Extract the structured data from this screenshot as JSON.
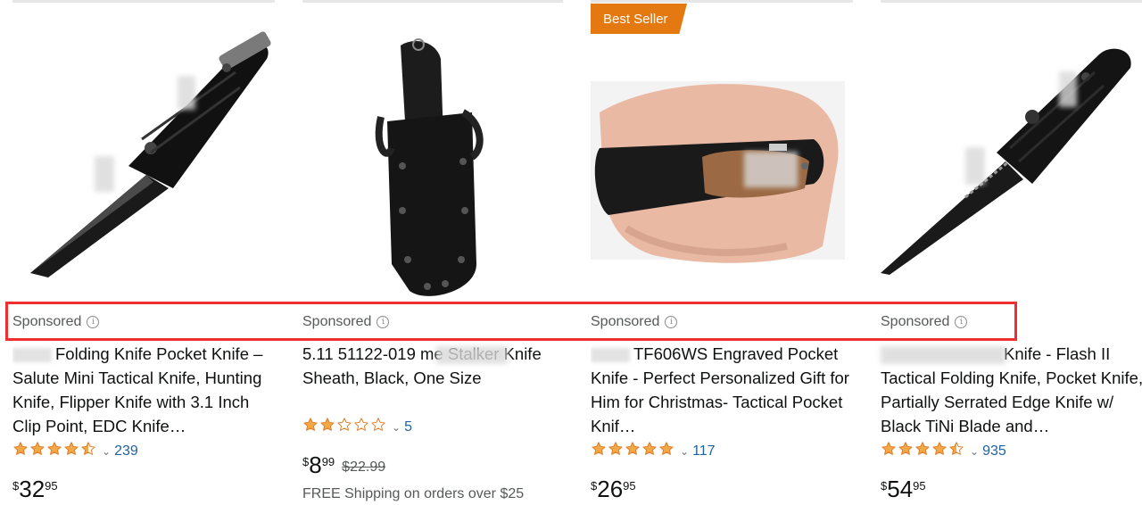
{
  "badge": "Best Seller",
  "products": [
    {
      "sponsored": "Sponsored",
      "title": "Folding Knife Pocket Knife – Salute Mini Tactical Knife, Hunting Knife, Flipper Knife with 3.1 Inch Clip Point, EDC Knife…",
      "rating": 4.5,
      "reviews": "239",
      "price": {
        "symbol": "$",
        "whole": "32",
        "fraction": "95"
      }
    },
    {
      "sponsored": "Sponsored",
      "title": "5.11 51122-019 me Stalker Knife Sheath, Black, One Size",
      "rating": 2,
      "reviews": "5",
      "price": {
        "symbol": "$",
        "whole": "8",
        "fraction": "99",
        "list": "$22.99"
      },
      "shipping": "FREE Shipping on orders over $25"
    },
    {
      "sponsored": "Sponsored",
      "title": "TF606WS Engraved Pocket Knife - Perfect Personalized Gift for Him for Christmas- Tactical Pocket Knif…",
      "rating": 5,
      "reviews": "117",
      "price": {
        "symbol": "$",
        "whole": "26",
        "fraction": "95"
      }
    },
    {
      "sponsored": "Sponsored",
      "title": "Knife - Flash II Tactical Folding Knife, Pocket Knife, Partially Serrated Edge Knife w/ Black TiNi Blade and…",
      "rating": 4.5,
      "reviews": "935",
      "price": {
        "symbol": "$",
        "whole": "54",
        "fraction": "95"
      }
    }
  ],
  "colors": {
    "star": "#f3a847",
    "link": "#2162a1",
    "badge": "#e47911",
    "highlight": "#ef2f2f"
  }
}
